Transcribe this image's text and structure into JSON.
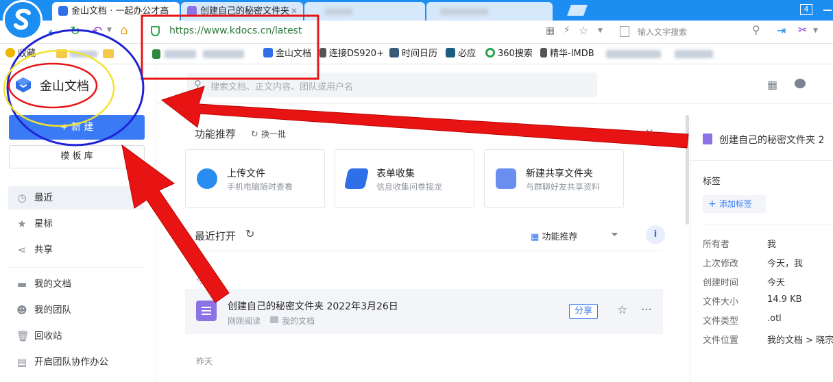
{
  "browser": {
    "tabs": [
      {
        "title": "金山文档 · 一起办公才高"
      },
      {
        "title": "创建自己的秘密文件夹"
      }
    ],
    "tab_count": "4",
    "url": "https://www.kdocs.cn/latest",
    "search_placeholder": "输入文字搜索",
    "bookmarks": {
      "favorites": "收藏",
      "items": [
        "金山文档",
        "连接DS920+",
        "时间日历",
        "必应",
        "360搜索",
        "精华-IMDB"
      ]
    }
  },
  "app": {
    "logo_text": "金山文档",
    "new_button": "+ 新 建",
    "template_button": "模 板 库",
    "nav": {
      "recent": "最近",
      "starred": "星标",
      "shared": "共享",
      "my_docs": "我的文档",
      "my_team": "我的团队",
      "trash": "回收站",
      "team_office": "开启团队协作办公"
    },
    "search_placeholder": "搜索文档、正文内容、团队或用户名",
    "features": {
      "title": "功能推荐",
      "refresh": "换一批",
      "cards": [
        {
          "title": "上传文件",
          "sub": "手机电脑随时查看"
        },
        {
          "title": "表单收集",
          "sub": "信息收集问卷接龙"
        },
        {
          "title": "新建共享文件夹",
          "sub": "与群聊好友共享资料"
        }
      ]
    },
    "recent": {
      "title": "最近打开",
      "feature_toggle": "功能推荐",
      "group_today": "今天",
      "group_yesterday": "昨天",
      "file": {
        "name": "创建自己的秘密文件夹 2022年3月26日",
        "meta_time": "刚刚阅读",
        "meta_location": "我的文档",
        "share": "分享"
      }
    },
    "detail": {
      "title": "创建自己的秘密文件夹 2",
      "tags_label": "标签",
      "add_tag": "添加标签",
      "props": [
        {
          "k": "所有者",
          "v": "我"
        },
        {
          "k": "上次修改",
          "v": "今天，我"
        },
        {
          "k": "创建时间",
          "v": "今天"
        },
        {
          "k": "文件大小",
          "v": "14.9 KB"
        },
        {
          "k": "文件类型",
          "v": ".otl"
        },
        {
          "k": "文件位置",
          "v": "我的文档 > 晓宗"
        }
      ]
    }
  },
  "colors": {
    "accent": "#3a7bf5",
    "browser_tab": "#1c8ef2",
    "annotation_red": "#e81414",
    "annotation_blue": "#1f22d6",
    "annotation_yellow": "#f2e230",
    "file_icon": "#8b73e6"
  }
}
